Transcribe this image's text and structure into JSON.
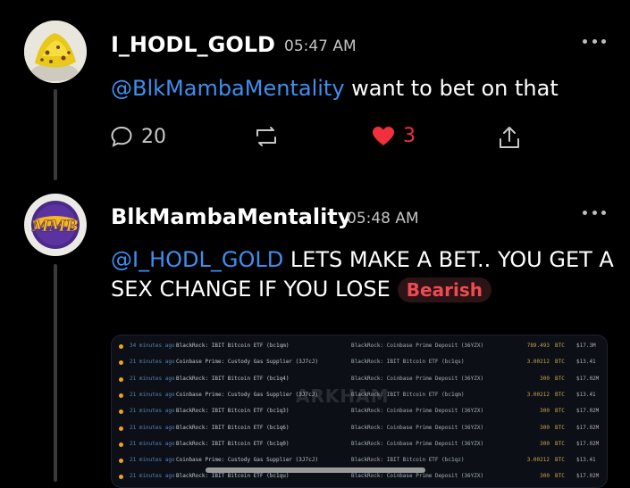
{
  "posts": [
    {
      "username": "I_HODL_GOLD",
      "time": "05:47 AM",
      "mention": "@BlkMambaMentality",
      "text": " want to bet on that",
      "comments": "20",
      "likes": "3"
    },
    {
      "username": "BlkMambaMentality",
      "time": "05:48 AM",
      "mention": "@I_HODL_GOLD",
      "line1": " LETS MAKE A BET.. YOU GET A",
      "line2": "SEX CHANGE IF YOU LOSE",
      "sentiment": "Bearish"
    }
  ],
  "colors": {
    "mention": "#3d8ff0",
    "like": "#f0303c",
    "bearish": "#ef4a52"
  },
  "icons": [
    "avatar-gold-nugget",
    "avatar-mamba-logo",
    "more-icon",
    "comment-icon",
    "repost-icon",
    "heart-icon",
    "share-icon"
  ],
  "media": {
    "watermark": "ARKHAM",
    "rows": [
      {
        "ago": "34 minutes ago",
        "from": "BlackRock: IBIT Bitcoin ETF (bc1qm)",
        "to": "BlackRock: Coinbase Prime Deposit (36YZX)",
        "amount": "789.493",
        "unit": "BTC",
        "usd": "$17.3M"
      },
      {
        "ago": "21 minutes ago",
        "from": "Coinbase Prime: Custody Gas Supplier (3J7cJ)",
        "to": "BlackRock: IBIT Bitcoin ETF (bc1qs)",
        "amount": "3.00212",
        "unit": "BTC",
        "usd": "$13.41"
      },
      {
        "ago": "21 minutes ago",
        "from": "BlackRock: IBIT Bitcoin ETF (bc1q4)",
        "to": "BlackRock: Coinbase Prime Deposit (36YZX)",
        "amount": "300",
        "unit": "BTC",
        "usd": "$17.02M"
      },
      {
        "ago": "21 minutes ago",
        "from": "Coinbase Prime: Custody Gas Supplier (3J7cJ)",
        "to": "BlackRock: IBIT Bitcoin ETF (bc1qm)",
        "amount": "3.00212",
        "unit": "BTC",
        "usd": "$13.41"
      },
      {
        "ago": "21 minutes ago",
        "from": "BlackRock: IBIT Bitcoin ETF (bc1q3)",
        "to": "BlackRock: Coinbase Prime Deposit (36YZX)",
        "amount": "300",
        "unit": "BTC",
        "usd": "$17.02M"
      },
      {
        "ago": "21 minutes ago",
        "from": "BlackRock: IBIT Bitcoin ETF (bc1q6)",
        "to": "BlackRock: Coinbase Prime Deposit (36YZX)",
        "amount": "300",
        "unit": "BTC",
        "usd": "$17.02M"
      },
      {
        "ago": "21 minutes ago",
        "from": "BlackRock: IBIT Bitcoin ETF (bc1q0)",
        "to": "BlackRock: Coinbase Prime Deposit (36YZX)",
        "amount": "300",
        "unit": "BTC",
        "usd": "$17.02M"
      },
      {
        "ago": "21 minutes ago",
        "from": "Coinbase Prime: Custody Gas Supplier (3J7cJ)",
        "to": "BlackRock: IBIT Bitcoin ETF (bc1qz)",
        "amount": "3.00212",
        "unit": "BTC",
        "usd": "$13.41"
      },
      {
        "ago": "21 minutes ago",
        "from": "BlackRock: IBIT Bitcoin ETF (bc1qu)",
        "to": "BlackRock: Coinbase Prime Deposit (36YZX)",
        "amount": "300",
        "unit": "BTC",
        "usd": "$17.02M"
      }
    ]
  }
}
